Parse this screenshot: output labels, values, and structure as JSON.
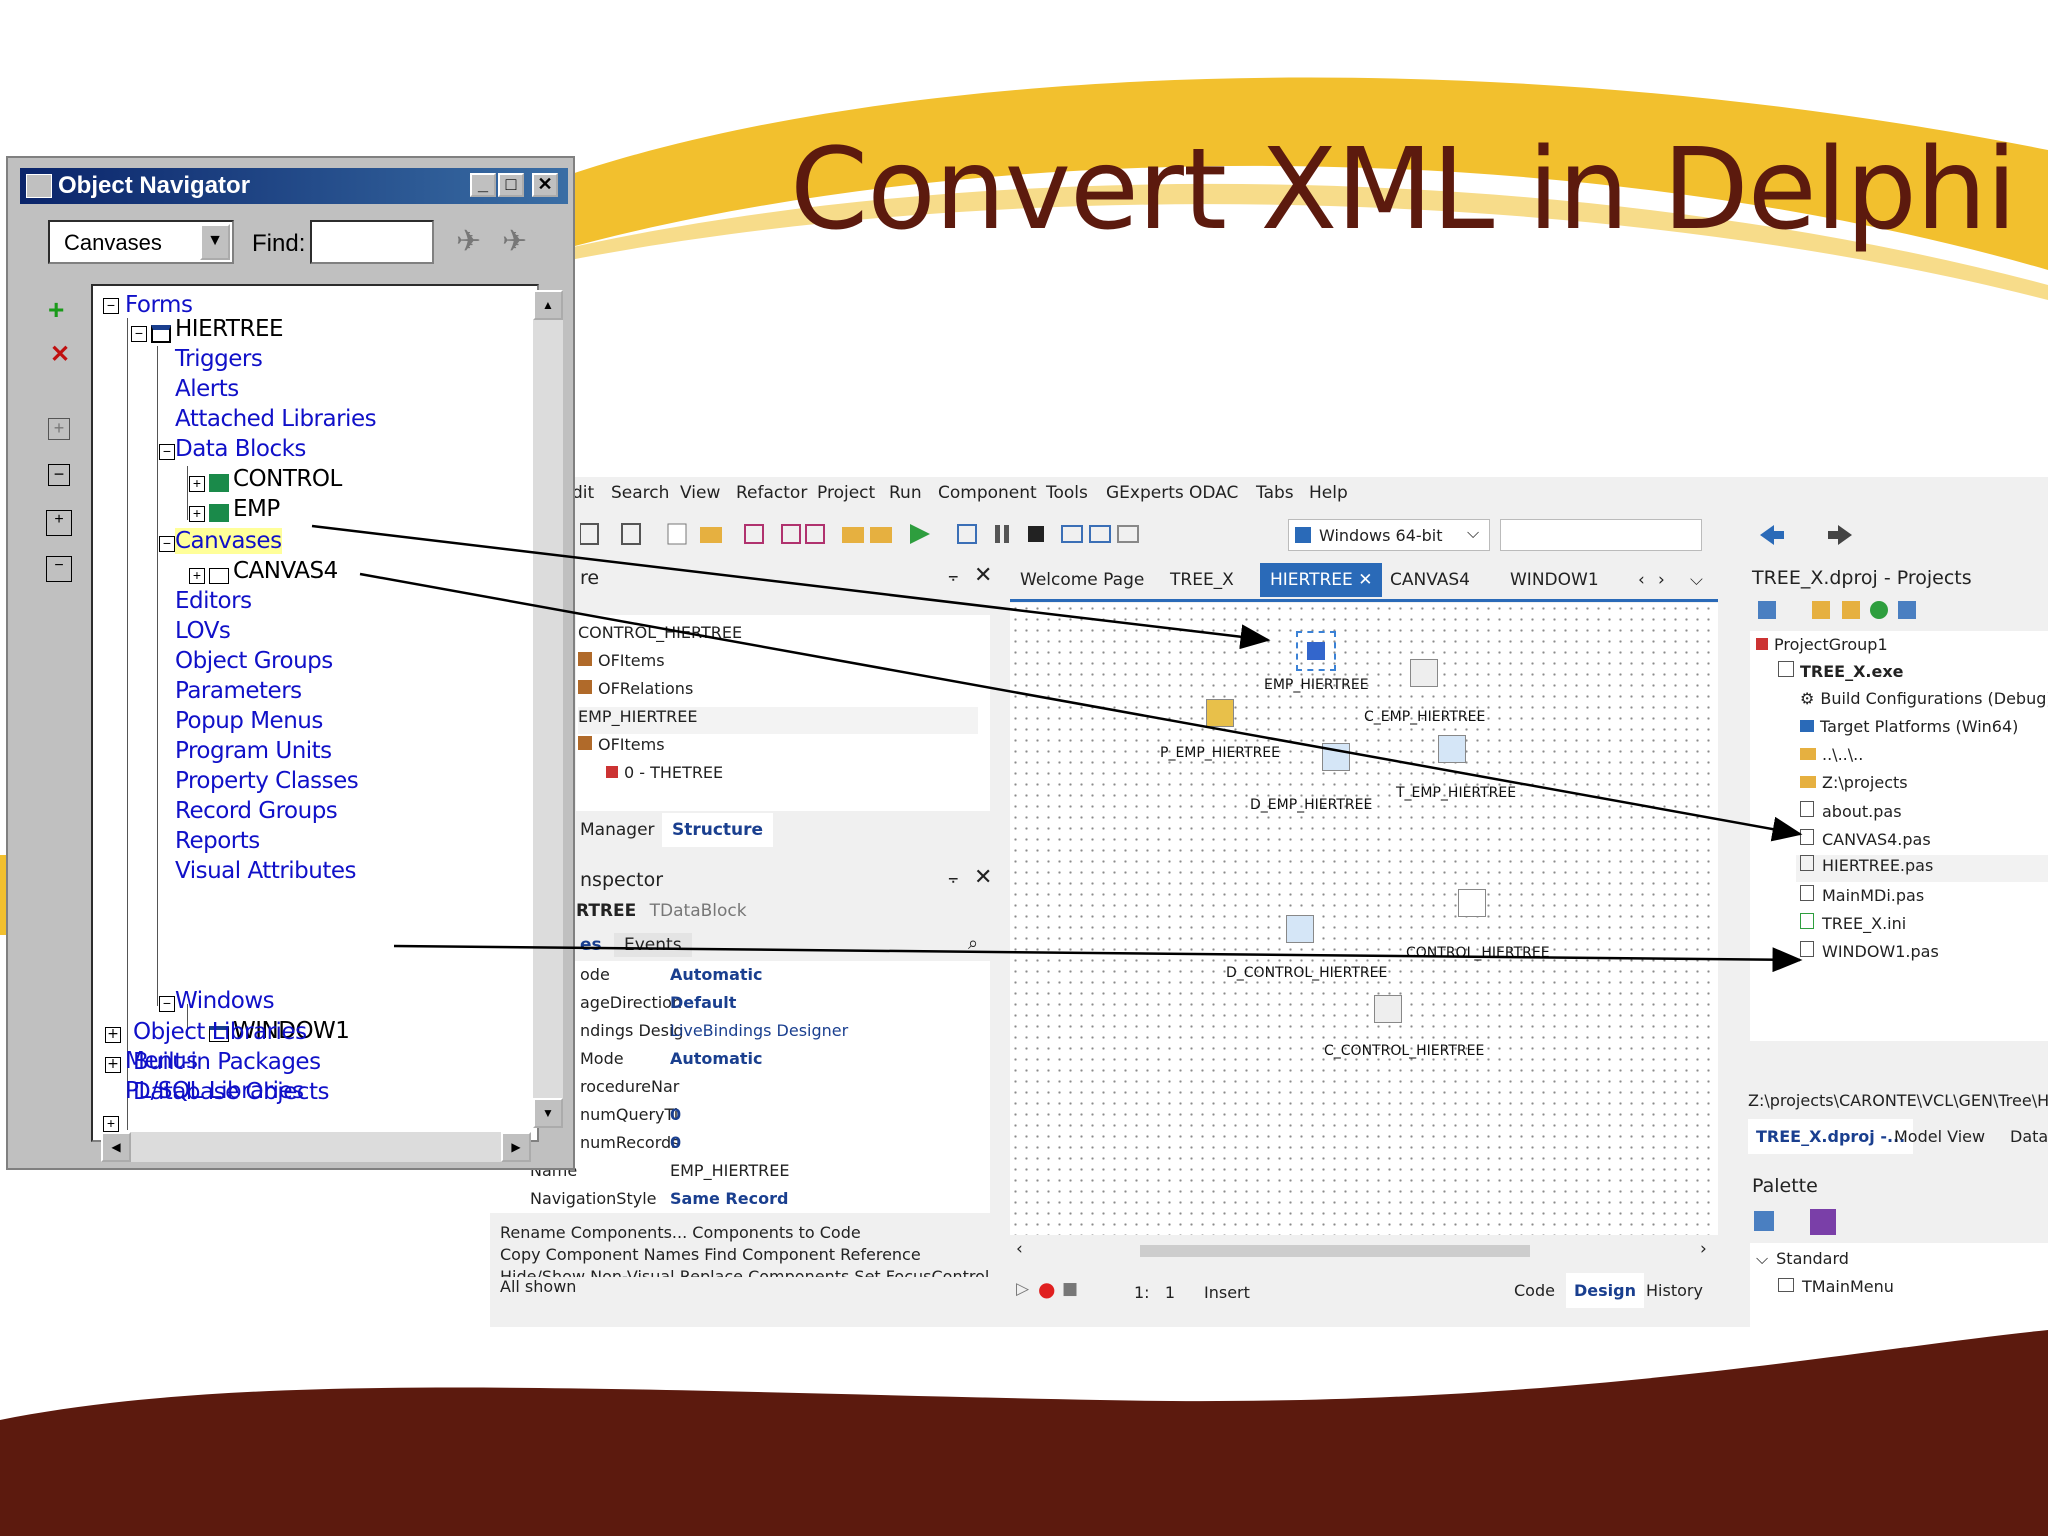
{
  "slide": {
    "title": "Convert XML in Delphi",
    "colors": {
      "title": "#5c1a0e",
      "swoosh": "#f2c02e",
      "footer": "#5c1a0e"
    }
  },
  "navigator": {
    "title": "Object Navigator",
    "dropdown_value": "Canvases",
    "find_label": "Find:",
    "find_value": "",
    "tree": {
      "forms": "Forms",
      "hiertree": "HIERTREE",
      "triggers": "Triggers",
      "alerts": "Alerts",
      "attached_libraries": "Attached Libraries",
      "data_blocks": "Data Blocks",
      "control": "CONTROL",
      "emp": "EMP",
      "canvases": "Canvases",
      "canvas4": "CANVAS4",
      "editors": "Editors",
      "lovs": "LOVs",
      "object_groups": "Object Groups",
      "parameters": "Parameters",
      "popup_menus": "Popup Menus",
      "program_units": "Program Units",
      "property_classes": "Property Classes",
      "record_groups": "Record Groups",
      "reports": "Reports",
      "visual_attributes": "Visual Attributes",
      "windows": "Windows",
      "window1": "WINDOW1",
      "menus": "Menus",
      "plsql_libraries": "PL/SQL Libraries",
      "object_libraries": "Object Libraries",
      "builtin_packages": "Built-in Packages",
      "database_objects": "Database Objects"
    }
  },
  "ide": {
    "menu": [
      "dit",
      "Search",
      "View",
      "Refactor",
      "Project",
      "Run",
      "Component",
      "Tools",
      "GExperts",
      "ODAC",
      "Tabs",
      "Help"
    ],
    "platform": "Windows 64-bit",
    "structure": {
      "title": "re",
      "items": [
        "CONTROL_HIERTREE",
        "OFItems",
        "OFRelations",
        "EMP_HIERTREE",
        "OFItems",
        "0 - THETREE"
      ],
      "tabs": [
        "Manager",
        "Structure"
      ]
    },
    "inspector": {
      "title": "nspector",
      "selected_name": "RTREE",
      "selected_type": "TDataBlock",
      "tabs": [
        "es",
        "Events"
      ],
      "props": [
        {
          "name": "ode",
          "value": "Automatic"
        },
        {
          "name": "ageDirection",
          "value": "Default"
        },
        {
          "name": "ndings Desig",
          "value": "LiveBindings Designer"
        },
        {
          "name": "Mode",
          "value": "Automatic"
        },
        {
          "name": "rocedureNar",
          "value": ""
        },
        {
          "name": "numQueryTi",
          "value": "0"
        },
        {
          "name": "numRecords",
          "value": "0"
        },
        {
          "name": "Name",
          "value": "EMP_HIERTREE"
        },
        {
          "name": "NavigationStyle",
          "value": "Same Record"
        }
      ],
      "actions": [
        "Rename Components...",
        "Components to Code",
        "Copy Component Names",
        "Find Component Reference",
        "Hide/Show Non-Visual",
        "Replace Components",
        "Set FocusControl"
      ],
      "status": "All shown"
    },
    "designer": {
      "tabs": [
        "Welcome Page",
        "TREE_X",
        "HIERTREE",
        "CANVAS4",
        "WINDOW1"
      ],
      "components": [
        "EMP_HIERTREE",
        "C_EMP_HIERTREE",
        "P_EMP_HIERTREE",
        "D_EMP_HIERTREE",
        "T_EMP_HIERTREE",
        "D_CONTROL_HIERTREE",
        "CONTROL_HIERTREE",
        "C_CONTROL_HIERTREE"
      ],
      "status_pos": "1:   1",
      "status_mode": "Insert",
      "bottom_tabs": [
        "Code",
        "Design",
        "History"
      ]
    },
    "projects": {
      "title": "TREE_X.dproj - Projects",
      "group": "ProjectGroup1",
      "exe": "TREE_X.exe",
      "items": [
        "Build Configurations (Debug)",
        "Target Platforms (Win64)",
        "..\\..\\..",
        "Z:\\projects",
        "about.pas",
        "CANVAS4.pas",
        "HIERTREE.pas",
        "MainMDi.pas",
        "TREE_X.ini",
        "WINDOW1.pas"
      ],
      "path": "Z:\\projects\\CARONTE\\VCL\\GEN\\Tree\\HIE",
      "tabs": [
        "TREE_X.dproj -...",
        "Model View",
        "Data"
      ]
    },
    "palette": {
      "title": "Palette",
      "category": "Standard",
      "first_item": "TMainMenu"
    }
  }
}
